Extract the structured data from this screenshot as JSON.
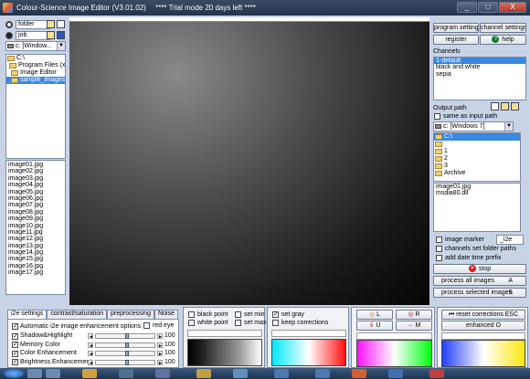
{
  "window": {
    "title": "Colour-Science Image Editor (V3.01.02)",
    "trial_notice": "**** Trial mode 20 days left ****",
    "buttons": [
      "_",
      "□",
      "X"
    ]
  },
  "left": {
    "mode_options": [
      "folder",
      "job"
    ],
    "drive": "c: [Window...",
    "tree": [
      {
        "label": "C:\\",
        "selected": false
      },
      {
        "label": "Program Files (x86",
        "selected": false
      },
      {
        "label": "Image Editor",
        "selected": false
      },
      {
        "label": "sample_images",
        "selected": true
      }
    ],
    "files": [
      "image01.jpg",
      "image02.jpg",
      "image03.jpg",
      "image04.jpg",
      "image05.jpg",
      "image06.jpg",
      "image07.jpg",
      "image08.jpg",
      "image09.jpg",
      "image10.jpg",
      "image11.jpg",
      "image12.jpg",
      "image13.jpg",
      "image14.jpg",
      "image15.jpg",
      "image16.jpg",
      "image17.jpg"
    ]
  },
  "right": {
    "program_settings": "program settings",
    "channel_settings": "channel settings",
    "register": "register",
    "help": "help",
    "channels_label": "Channels",
    "channels": [
      {
        "label": "1-default",
        "selected": true
      },
      {
        "label": "black and white",
        "selected": false
      },
      {
        "label": "sepia",
        "selected": false
      }
    ],
    "output_path_label": "Output path",
    "same_as_input": "same as input path",
    "output_drive": "c: [Windows 7]",
    "output_tree": [
      "C:\\",
      "",
      "1",
      "2",
      "3",
      "Archive"
    ],
    "output_files": [
      "image01.jpg",
      "msdia80.dll"
    ],
    "image_marker": "image marker",
    "image_marker_value": "_i2e",
    "channels_set_folder_paths": "channels set folder paths",
    "add_date_time_prefix": "add date time prefix",
    "stop": "stop",
    "process_all": "process all images",
    "process_all_key": "A",
    "process_selected": "process selected images",
    "process_selected_key": "S"
  },
  "bottom": {
    "tabs": [
      "i2e settings",
      "contrast/saturation",
      "preprocessing",
      "Noise"
    ],
    "auto_options": "Automatic i2e image enhancement options",
    "red_eye": "red eye",
    "controls": [
      {
        "name": "Shadow&Highlight",
        "value": "100",
        "level": 0.5
      },
      {
        "name": "Memory Color",
        "value": "100",
        "level": 0.5
      },
      {
        "name": "Color Enhancement",
        "value": "100",
        "level": 0.5
      },
      {
        "name": "Brightness Enhancement",
        "value": "100",
        "level": 0.5
      }
    ],
    "points": {
      "black_point": "black point",
      "white_point": "white point",
      "set_min": "set min",
      "set_max": "set max",
      "set_gray": "set gray",
      "keep_corrections": "keep corrections"
    },
    "color_buttons": {
      "L": "L",
      "R": "R",
      "U": "U",
      "M": "M"
    },
    "reset_corrections": "reset corrections ESC",
    "enhanced": "enhanced",
    "enhanced_key": "O"
  },
  "colors": {
    "selection": "#3a88e0",
    "titlebar": "#24344c",
    "stop": "#d02020"
  }
}
